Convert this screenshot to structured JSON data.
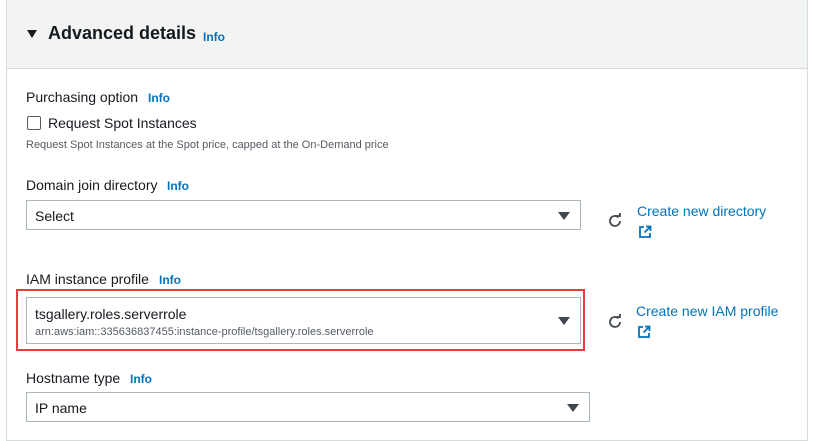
{
  "panel": {
    "title": "Advanced details",
    "info": "Info"
  },
  "purchasing": {
    "label": "Purchasing option",
    "info": "Info",
    "checkbox_label": "Request Spot Instances",
    "hint": "Request Spot Instances at the Spot price, capped at the On-Demand price"
  },
  "domain": {
    "label": "Domain join directory",
    "info": "Info",
    "value": "Select",
    "link": "Create new directory"
  },
  "iam": {
    "label": "IAM instance profile",
    "info": "Info",
    "value": "tsgallery.roles.serverrole",
    "arn": "arn:aws:iam::335636837455:instance-profile/tsgallery.roles.serverrole",
    "link": "Create new IAM profile"
  },
  "hostname": {
    "label": "Hostname type",
    "info": "Info",
    "value": "IP name"
  },
  "colors": {
    "link": "#0073bb",
    "highlight": "#e53d3d"
  }
}
